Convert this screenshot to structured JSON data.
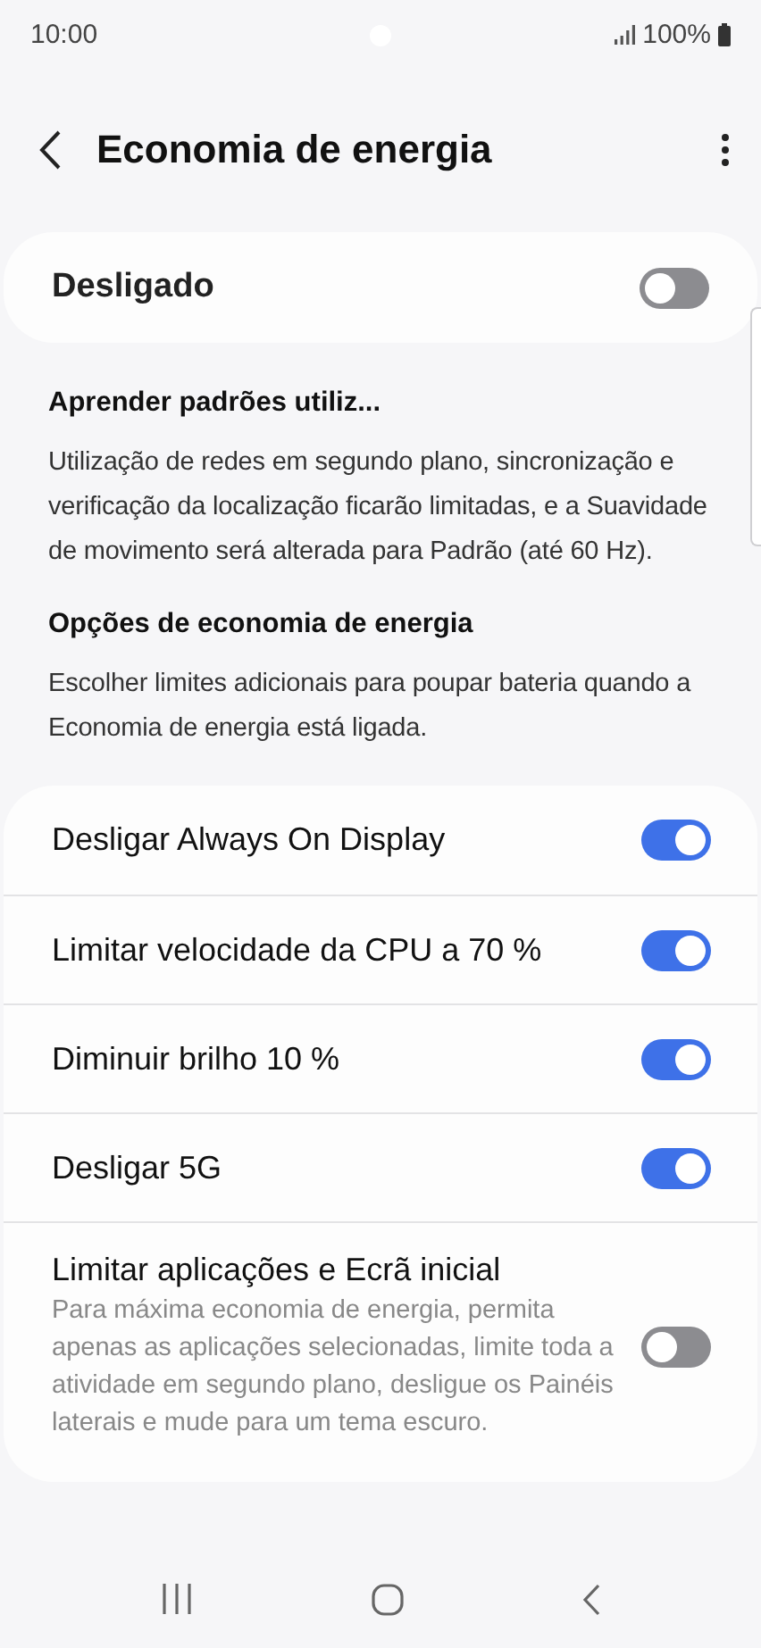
{
  "status_bar": {
    "time": "10:00",
    "battery": "100%"
  },
  "header": {
    "title": "Economia de energia"
  },
  "master": {
    "label": "Desligado",
    "on": false
  },
  "sections": [
    {
      "heading": "Aprender padrões utiliz...",
      "text": "Utilização de redes em segundo plano, sincronização e verificação da localização ficarão limitadas, e a Suavidade de movimento será alterada para Padrão (até 60 Hz)."
    },
    {
      "heading": "Opções de economia de energia",
      "text": "Escolher limites adicionais para poupar bateria quando a Economia de energia está ligada."
    }
  ],
  "options": [
    {
      "label": "Desligar Always On Display",
      "on": true
    },
    {
      "label": "Limitar velocidade da CPU a 70 %",
      "on": true
    },
    {
      "label": "Diminuir brilho 10 %",
      "on": true
    },
    {
      "label": "Desligar 5G",
      "on": true
    },
    {
      "label": "Limitar aplicações e Ecrã inicial",
      "description": "Para máxima economia de energia, permita apenas as aplicações selecionadas, limite toda a atividade em segundo plano, desligue os Painéis laterais e mude para um tema escuro.",
      "on": false
    }
  ]
}
